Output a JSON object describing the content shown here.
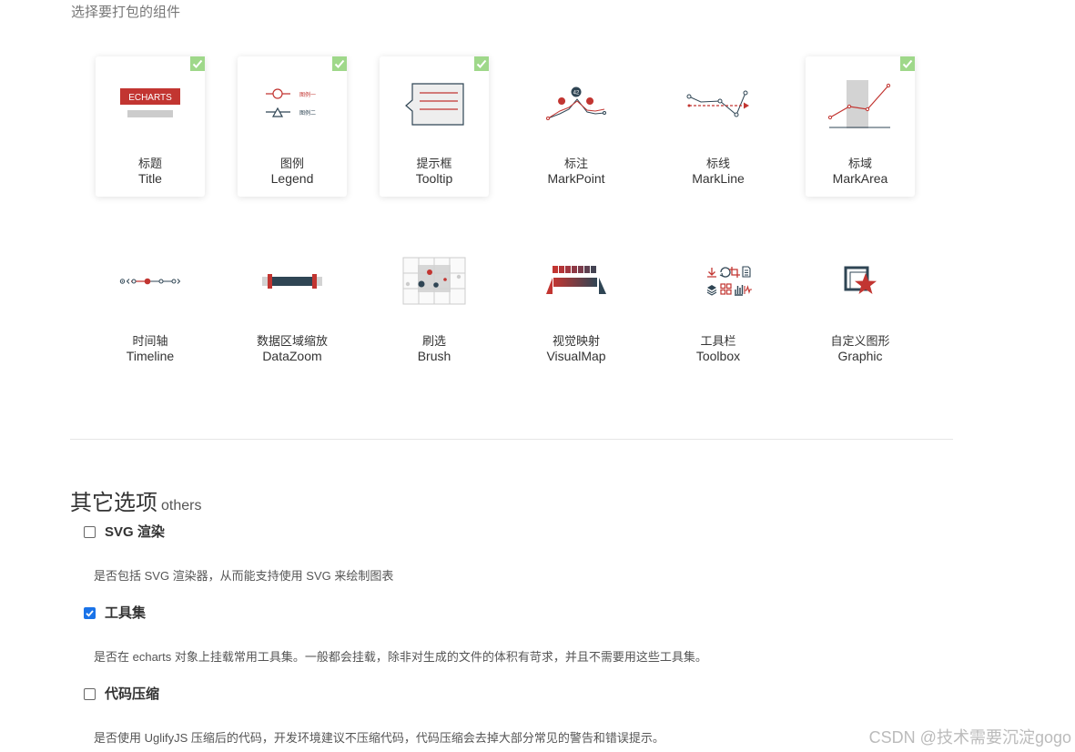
{
  "section_heading": "选择要打包的组件",
  "components": [
    {
      "zh": "标题",
      "en": "Title",
      "selected": true,
      "icon": "title-icon"
    },
    {
      "zh": "图例",
      "en": "Legend",
      "selected": true,
      "icon": "legend-icon"
    },
    {
      "zh": "提示框",
      "en": "Tooltip",
      "selected": true,
      "icon": "tooltip-icon"
    },
    {
      "zh": "标注",
      "en": "MarkPoint",
      "selected": false,
      "icon": "markpoint-icon"
    },
    {
      "zh": "标线",
      "en": "MarkLine",
      "selected": false,
      "icon": "markline-icon"
    },
    {
      "zh": "标域",
      "en": "MarkArea",
      "selected": true,
      "icon": "markarea-icon"
    },
    {
      "zh": "时间轴",
      "en": "Timeline",
      "selected": false,
      "icon": "timeline-icon"
    },
    {
      "zh": "数据区域缩放",
      "en": "DataZoom",
      "selected": false,
      "icon": "datazoom-icon"
    },
    {
      "zh": "刷选",
      "en": "Brush",
      "selected": false,
      "icon": "brush-icon"
    },
    {
      "zh": "视觉映射",
      "en": "VisualMap",
      "selected": false,
      "icon": "visualmap-icon"
    },
    {
      "zh": "工具栏",
      "en": "Toolbox",
      "selected": false,
      "icon": "toolbox-icon"
    },
    {
      "zh": "自定义图形",
      "en": "Graphic",
      "selected": false,
      "icon": "graphic-icon"
    }
  ],
  "icon_text": {
    "echarts": "ECHARTS",
    "legend_a": "图例一",
    "legend_b": "图例二",
    "markpoint_value": "42"
  },
  "others": {
    "title": "其它选项",
    "subtitle": "others",
    "options": [
      {
        "label": "SVG 渲染",
        "checked": false,
        "description": "是否包括 SVG 渲染器，从而能支持使用 SVG 来绘制图表"
      },
      {
        "label": "工具集",
        "checked": true,
        "description": "是否在 echarts 对象上挂载常用工具集。一般都会挂载，除非对生成的文件的体积有苛求，并且不需要用这些工具集。"
      },
      {
        "label": "代码压缩",
        "checked": false,
        "description": "是否使用 UglifyJS 压缩后的代码，开发环境建议不压缩代码，代码压缩会去掉大部分常见的警告和错误提示。"
      }
    ]
  },
  "watermark": "CSDN @技术需要沉淀gogo",
  "colors": {
    "accent_red": "#c23531",
    "navy": "#2f4554",
    "check_green": "#9fd88a",
    "checkbox_blue": "#1a73e8"
  }
}
